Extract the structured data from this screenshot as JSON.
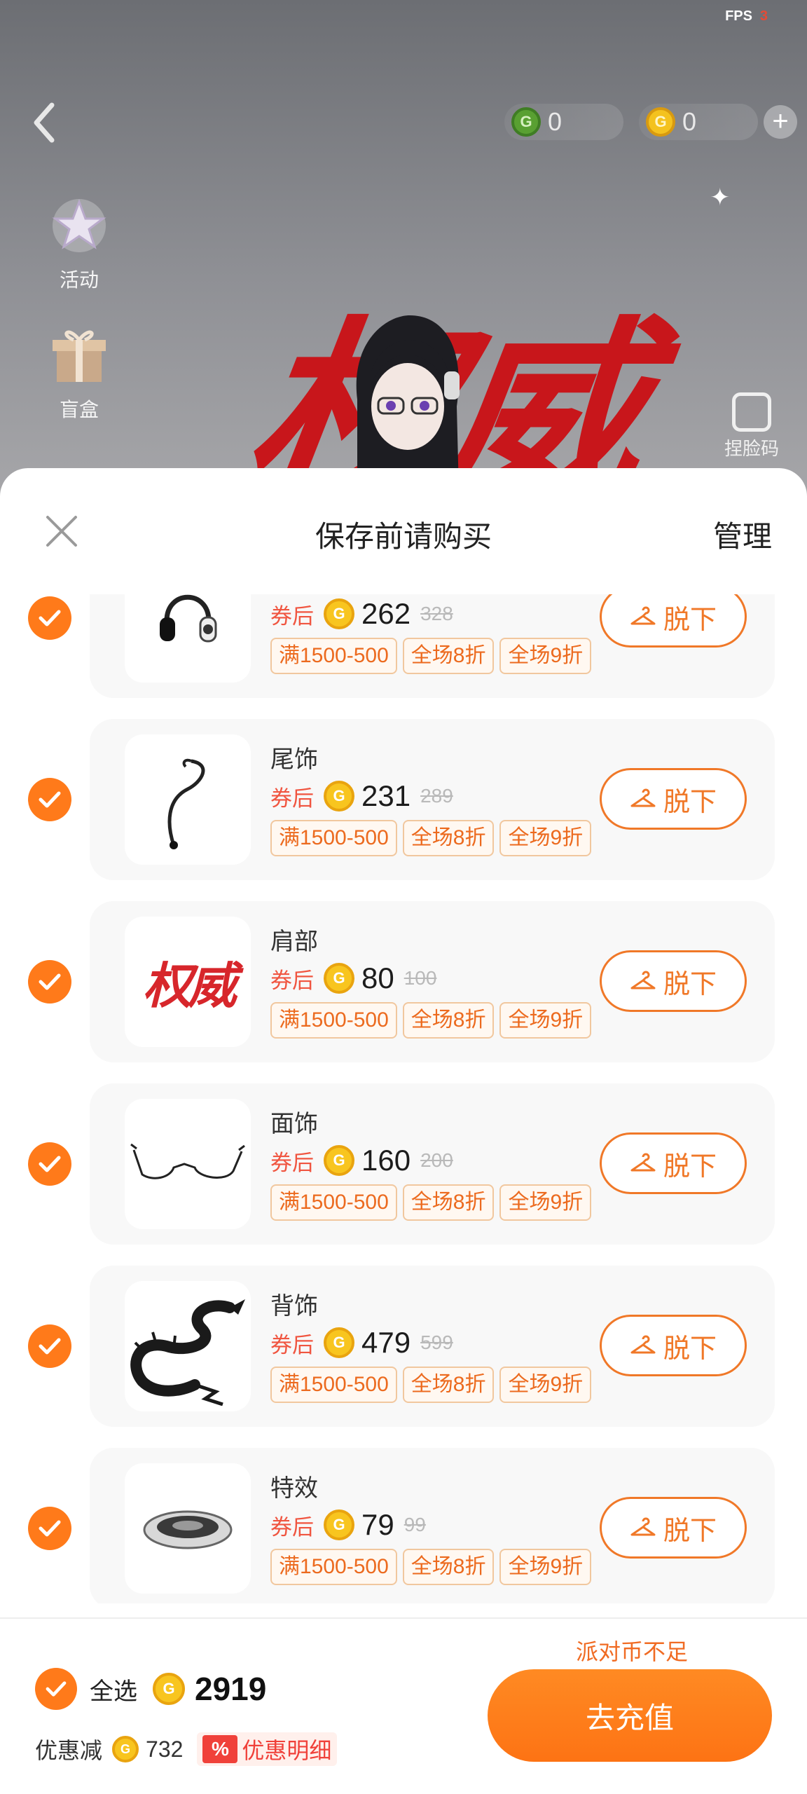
{
  "status": {
    "fps_label": "FPS",
    "fps_value": "3"
  },
  "currency": {
    "green_amount": "0",
    "gold_amount": "0",
    "coin_glyph": "G"
  },
  "side_menu": {
    "activity": "活动",
    "blind_box": "盲盒",
    "face_code": "捏脸码"
  },
  "background_text": "权威",
  "sheet": {
    "title": "保存前请购买",
    "manage": "管理"
  },
  "labels": {
    "after_coupon": "券后",
    "take_off": "脱下"
  },
  "items": [
    {
      "name": "",
      "price": "262",
      "original": "328",
      "tags": [
        "满1500-500",
        "全场8折",
        "全场9折"
      ],
      "icon": "headphones-icon"
    },
    {
      "name": "尾饰",
      "price": "231",
      "original": "289",
      "tags": [
        "满1500-500",
        "全场8折",
        "全场9折"
      ],
      "icon": "tail-icon"
    },
    {
      "name": "肩部",
      "price": "80",
      "original": "100",
      "tags": [
        "满1500-500",
        "全场8折",
        "全场9折"
      ],
      "icon": "shoulder-text-icon",
      "art_text": "权威"
    },
    {
      "name": "面饰",
      "price": "160",
      "original": "200",
      "tags": [
        "满1500-500",
        "全场8折",
        "全场9折"
      ],
      "icon": "glasses-icon"
    },
    {
      "name": "背饰",
      "price": "479",
      "original": "599",
      "tags": [
        "满1500-500",
        "全场8折",
        "全场9折"
      ],
      "icon": "dragon-icon"
    },
    {
      "name": "特效",
      "price": "79",
      "original": "99",
      "tags": [
        "满1500-500",
        "全场8折",
        "全场9折"
      ],
      "icon": "effect-disc-icon"
    }
  ],
  "footer": {
    "insufficient": "派对币不足",
    "select_all": "全选",
    "total": "2919",
    "discount_label": "优惠减",
    "discount_amount": "732",
    "detail_pct": "%",
    "detail_label": "优惠明细",
    "recharge": "去充值"
  },
  "colors": {
    "accent": "#ff7a1a",
    "coupon_red": "#f05540",
    "tag_text": "#ec6a1e"
  }
}
